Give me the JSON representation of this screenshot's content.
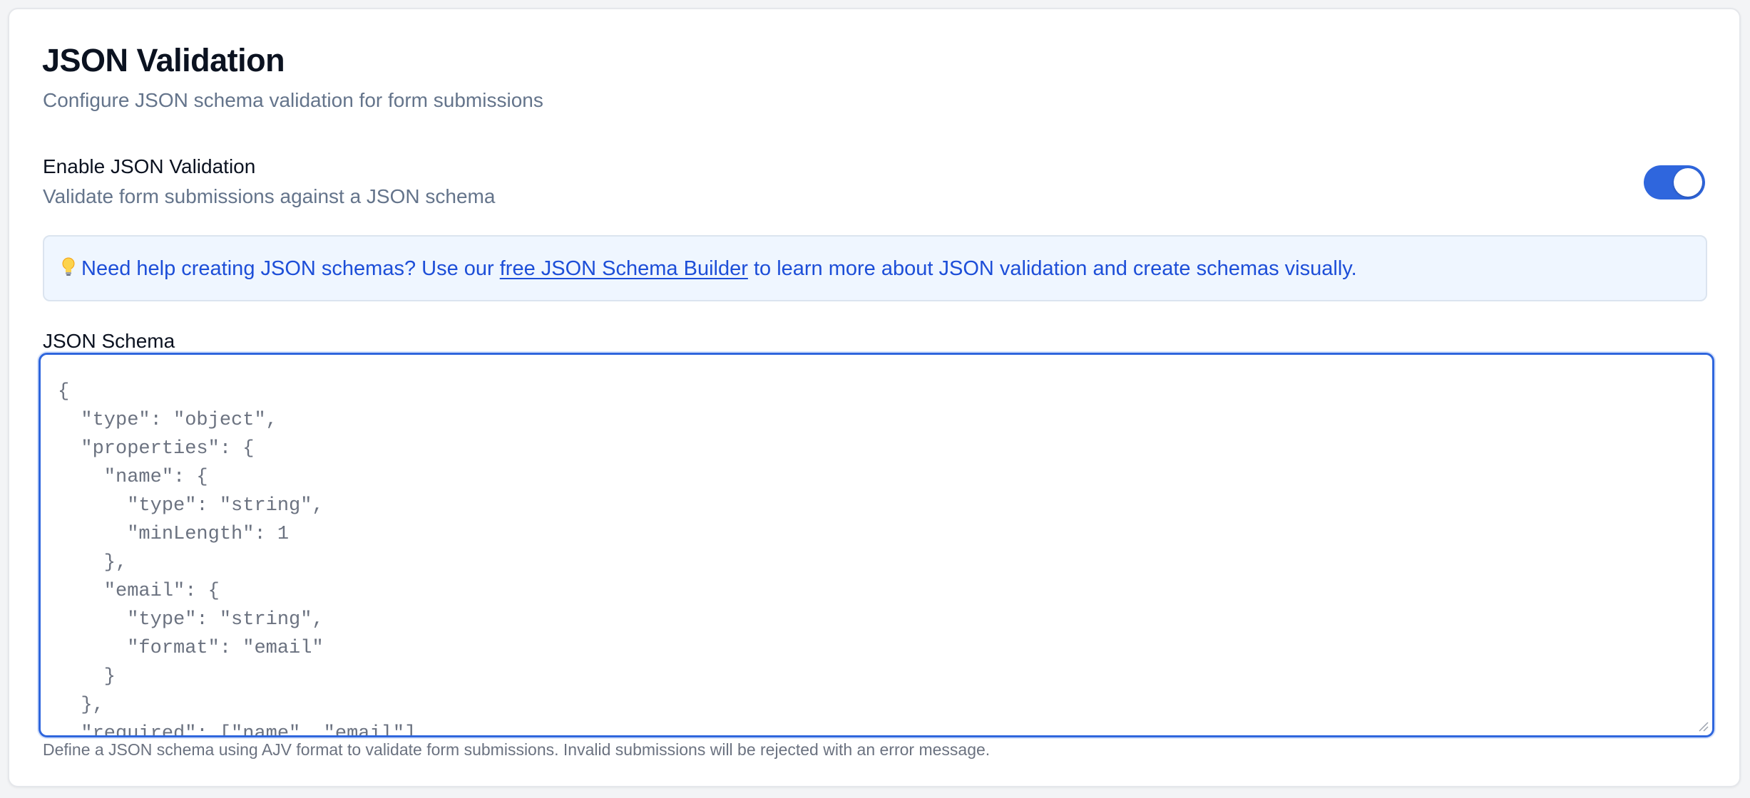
{
  "header": {
    "title": "JSON Validation",
    "subtitle": "Configure JSON schema validation for form submissions"
  },
  "enable_setting": {
    "label": "Enable JSON Validation",
    "description": "Validate form submissions against a JSON schema",
    "enabled": true
  },
  "info": {
    "icon": "lightbulb-icon",
    "text_before": "Need help creating JSON schemas? Use our ",
    "link_text": "free JSON Schema Builder",
    "text_after": " to learn more about JSON validation and create schemas visually."
  },
  "schema_field": {
    "label": "JSON Schema",
    "value": "{\n  \"type\": \"object\",\n  \"properties\": {\n    \"name\": {\n      \"type\": \"string\",\n      \"minLength\": 1\n    },\n    \"email\": {\n      \"type\": \"string\",\n      \"format\": \"email\"\n    }\n  },\n  \"required\": [\"name\", \"email\"]\n}",
    "help": "Define a JSON schema using AJV format to validate form submissions. Invalid submissions will be rejected with an error message."
  },
  "colors": {
    "accent": "#2f66dd",
    "info_bg": "#eff6ff",
    "info_text": "#1d4ed8",
    "muted_text": "#64748b"
  }
}
